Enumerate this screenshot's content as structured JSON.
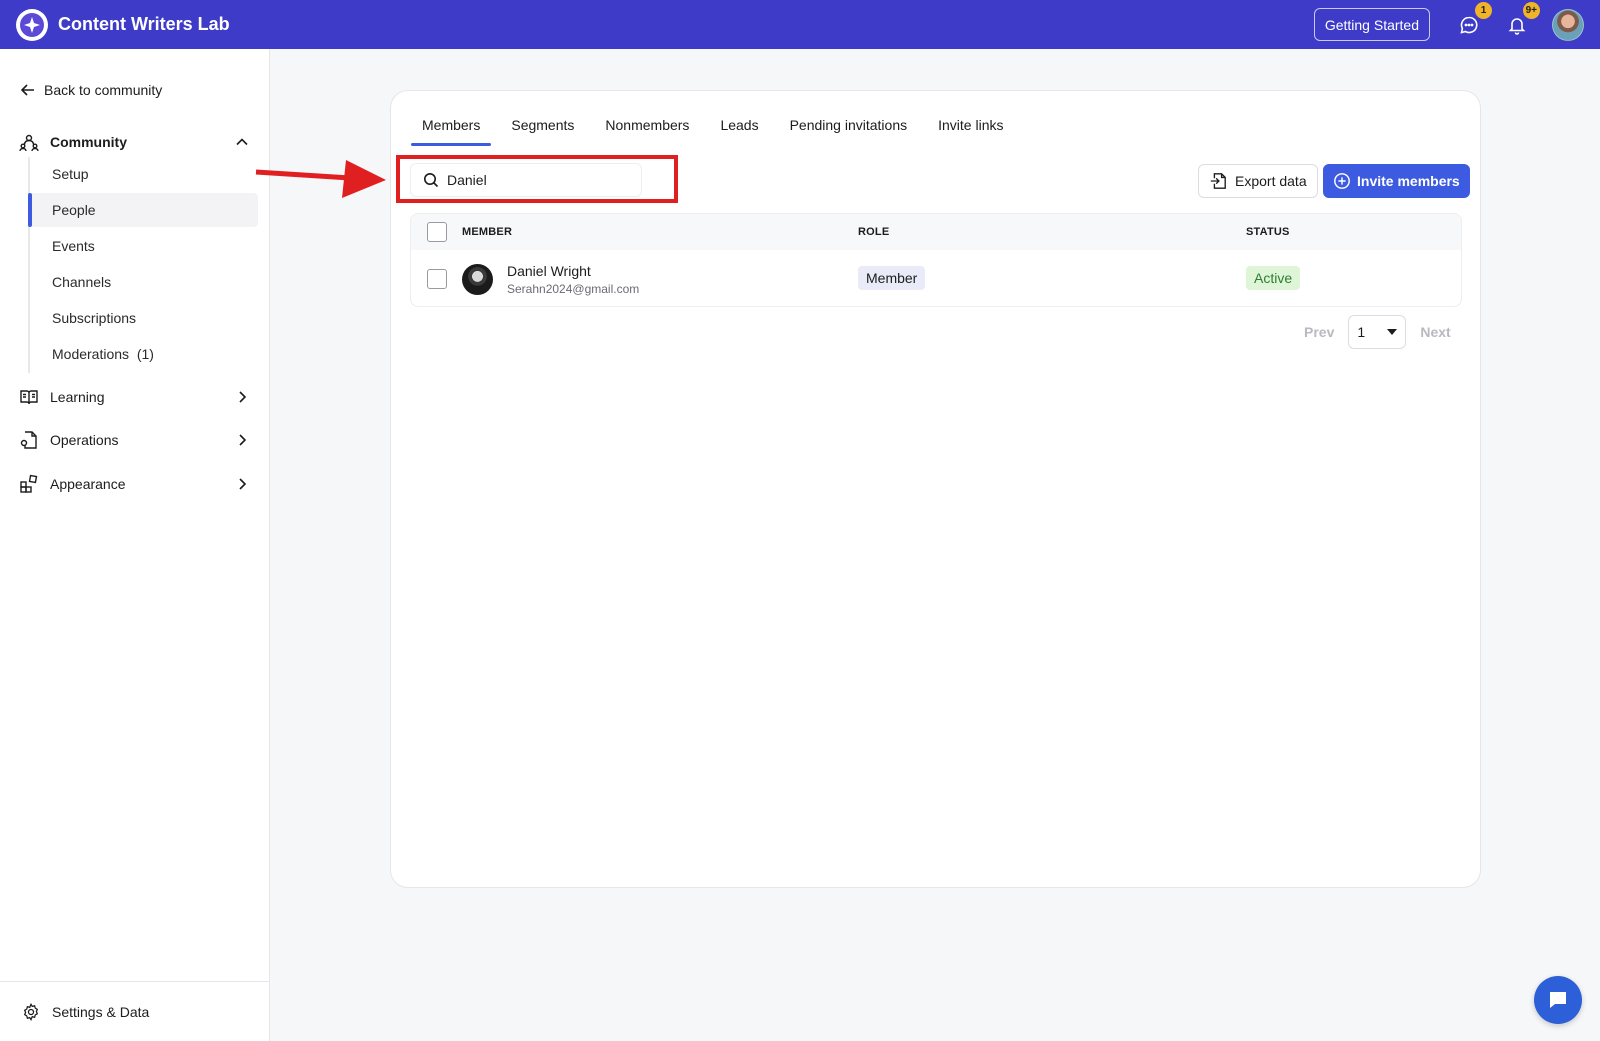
{
  "app": {
    "title": "Content Writers Lab"
  },
  "topbar": {
    "getting_started": "Getting Started",
    "messages_badge": "1",
    "notifications_badge": "9+"
  },
  "sidebar": {
    "back_link": "Back to community",
    "community": {
      "label": "Community",
      "items": [
        {
          "label": "Setup"
        },
        {
          "label": "People"
        },
        {
          "label": "Events"
        },
        {
          "label": "Channels"
        },
        {
          "label": "Subscriptions"
        },
        {
          "label": "Moderations  (1)"
        }
      ]
    },
    "learning": {
      "label": "Learning"
    },
    "operations": {
      "label": "Operations"
    },
    "appearance": {
      "label": "Appearance"
    },
    "settings": {
      "label": "Settings & Data"
    }
  },
  "main": {
    "tabs": [
      {
        "label": "Members"
      },
      {
        "label": "Segments"
      },
      {
        "label": "Nonmembers"
      },
      {
        "label": "Leads"
      },
      {
        "label": "Pending invitations"
      },
      {
        "label": "Invite links"
      }
    ],
    "search": {
      "value": "Daniel",
      "placeholder": ""
    },
    "export_label": "Export data",
    "invite_label": "Invite members",
    "table": {
      "headers": {
        "member": "MEMBER",
        "role": "ROLE",
        "status": "STATUS"
      },
      "rows": [
        {
          "name": "Daniel Wright",
          "email": "Serahn2024@gmail.com",
          "role": "Member",
          "status": "Active"
        }
      ]
    },
    "pager": {
      "prev": "Prev",
      "page": "1",
      "next": "Next"
    }
  },
  "colors": {
    "brand": "#3d3bc8",
    "accent": "#3d5be0",
    "highlight": "#e02020",
    "status_active": "#dff5d8"
  }
}
